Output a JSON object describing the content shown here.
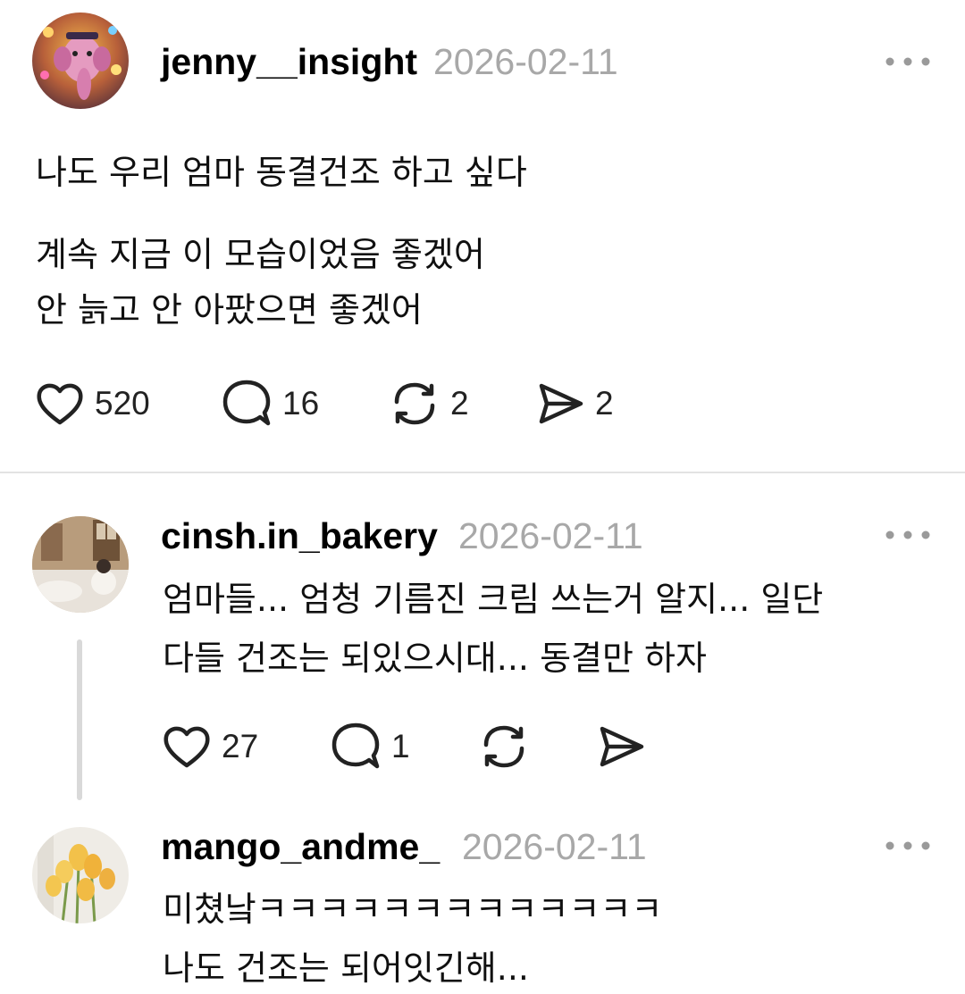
{
  "post": {
    "username": "jenny__insight",
    "date": "2026-02-11",
    "paragraphs": [
      "나도 우리 엄마 동결건조 하고 싶다",
      "계속 지금 이 모습이었음 좋겠어",
      "안 늙고 안 아팠으면 좋겠어"
    ],
    "likes": "520",
    "comments": "16",
    "reposts": "2",
    "shares": "2"
  },
  "replies": [
    {
      "username": "cinsh.in_bakery",
      "date": "2026-02-11",
      "lines": [
        "엄마들... 엄청 기름진 크림 쓰는거 알지... 일단",
        "다들 건조는 되있으시대... 동결만 하자"
      ],
      "likes": "27",
      "comments": "1"
    },
    {
      "username": "mango_andme_",
      "date": "2026-02-11",
      "lines": [
        "미쳤낰ㅋㅋㅋㅋㅋㅋㅋㅋㅋㅋㅋㅋㅋ",
        "나도 건조는 되어잇긴해..."
      ]
    }
  ],
  "icons": {
    "like": "heart-icon",
    "comment": "speech-bubble-icon",
    "repost": "repost-arrows-icon",
    "share": "paper-plane-icon",
    "more": "more-horizontal-icon"
  },
  "colors": {
    "text": "#000000",
    "secondary": "#a8a8a8",
    "divider": "#e3e3e3"
  }
}
